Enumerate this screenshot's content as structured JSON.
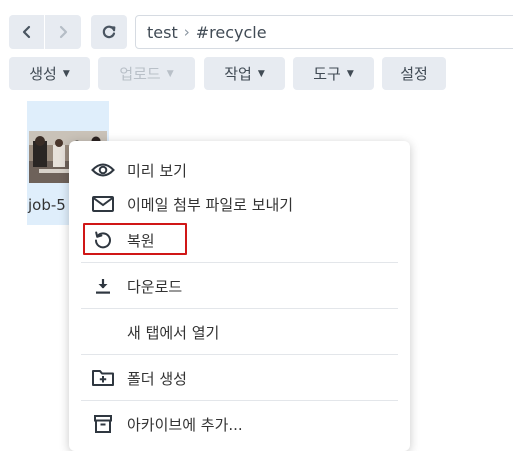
{
  "nav": {
    "back_icon": "chevron-left-icon",
    "forward_icon": "chevron-right-icon",
    "refresh_icon": "refresh-icon"
  },
  "path": {
    "segments": [
      "test",
      "#recycle"
    ],
    "separator": "›"
  },
  "toolbar": {
    "create": "생성",
    "upload": "업로드",
    "action": "작업",
    "tools": "도구",
    "settings": "설정"
  },
  "file": {
    "name": "job-5"
  },
  "context_menu": {
    "preview": "미리 보기",
    "email": "이메일 첨부 파일로 보내기",
    "restore": "복원",
    "download": "다운로드",
    "open_new_tab": "새 탭에서 열기",
    "new_folder": "폴더 생성",
    "add_archive": "아카이브에 추가..."
  },
  "colors": {
    "selected_tile": "#dfeefb",
    "button_bg": "#e7ebf1",
    "highlight_border": "#d01717"
  }
}
